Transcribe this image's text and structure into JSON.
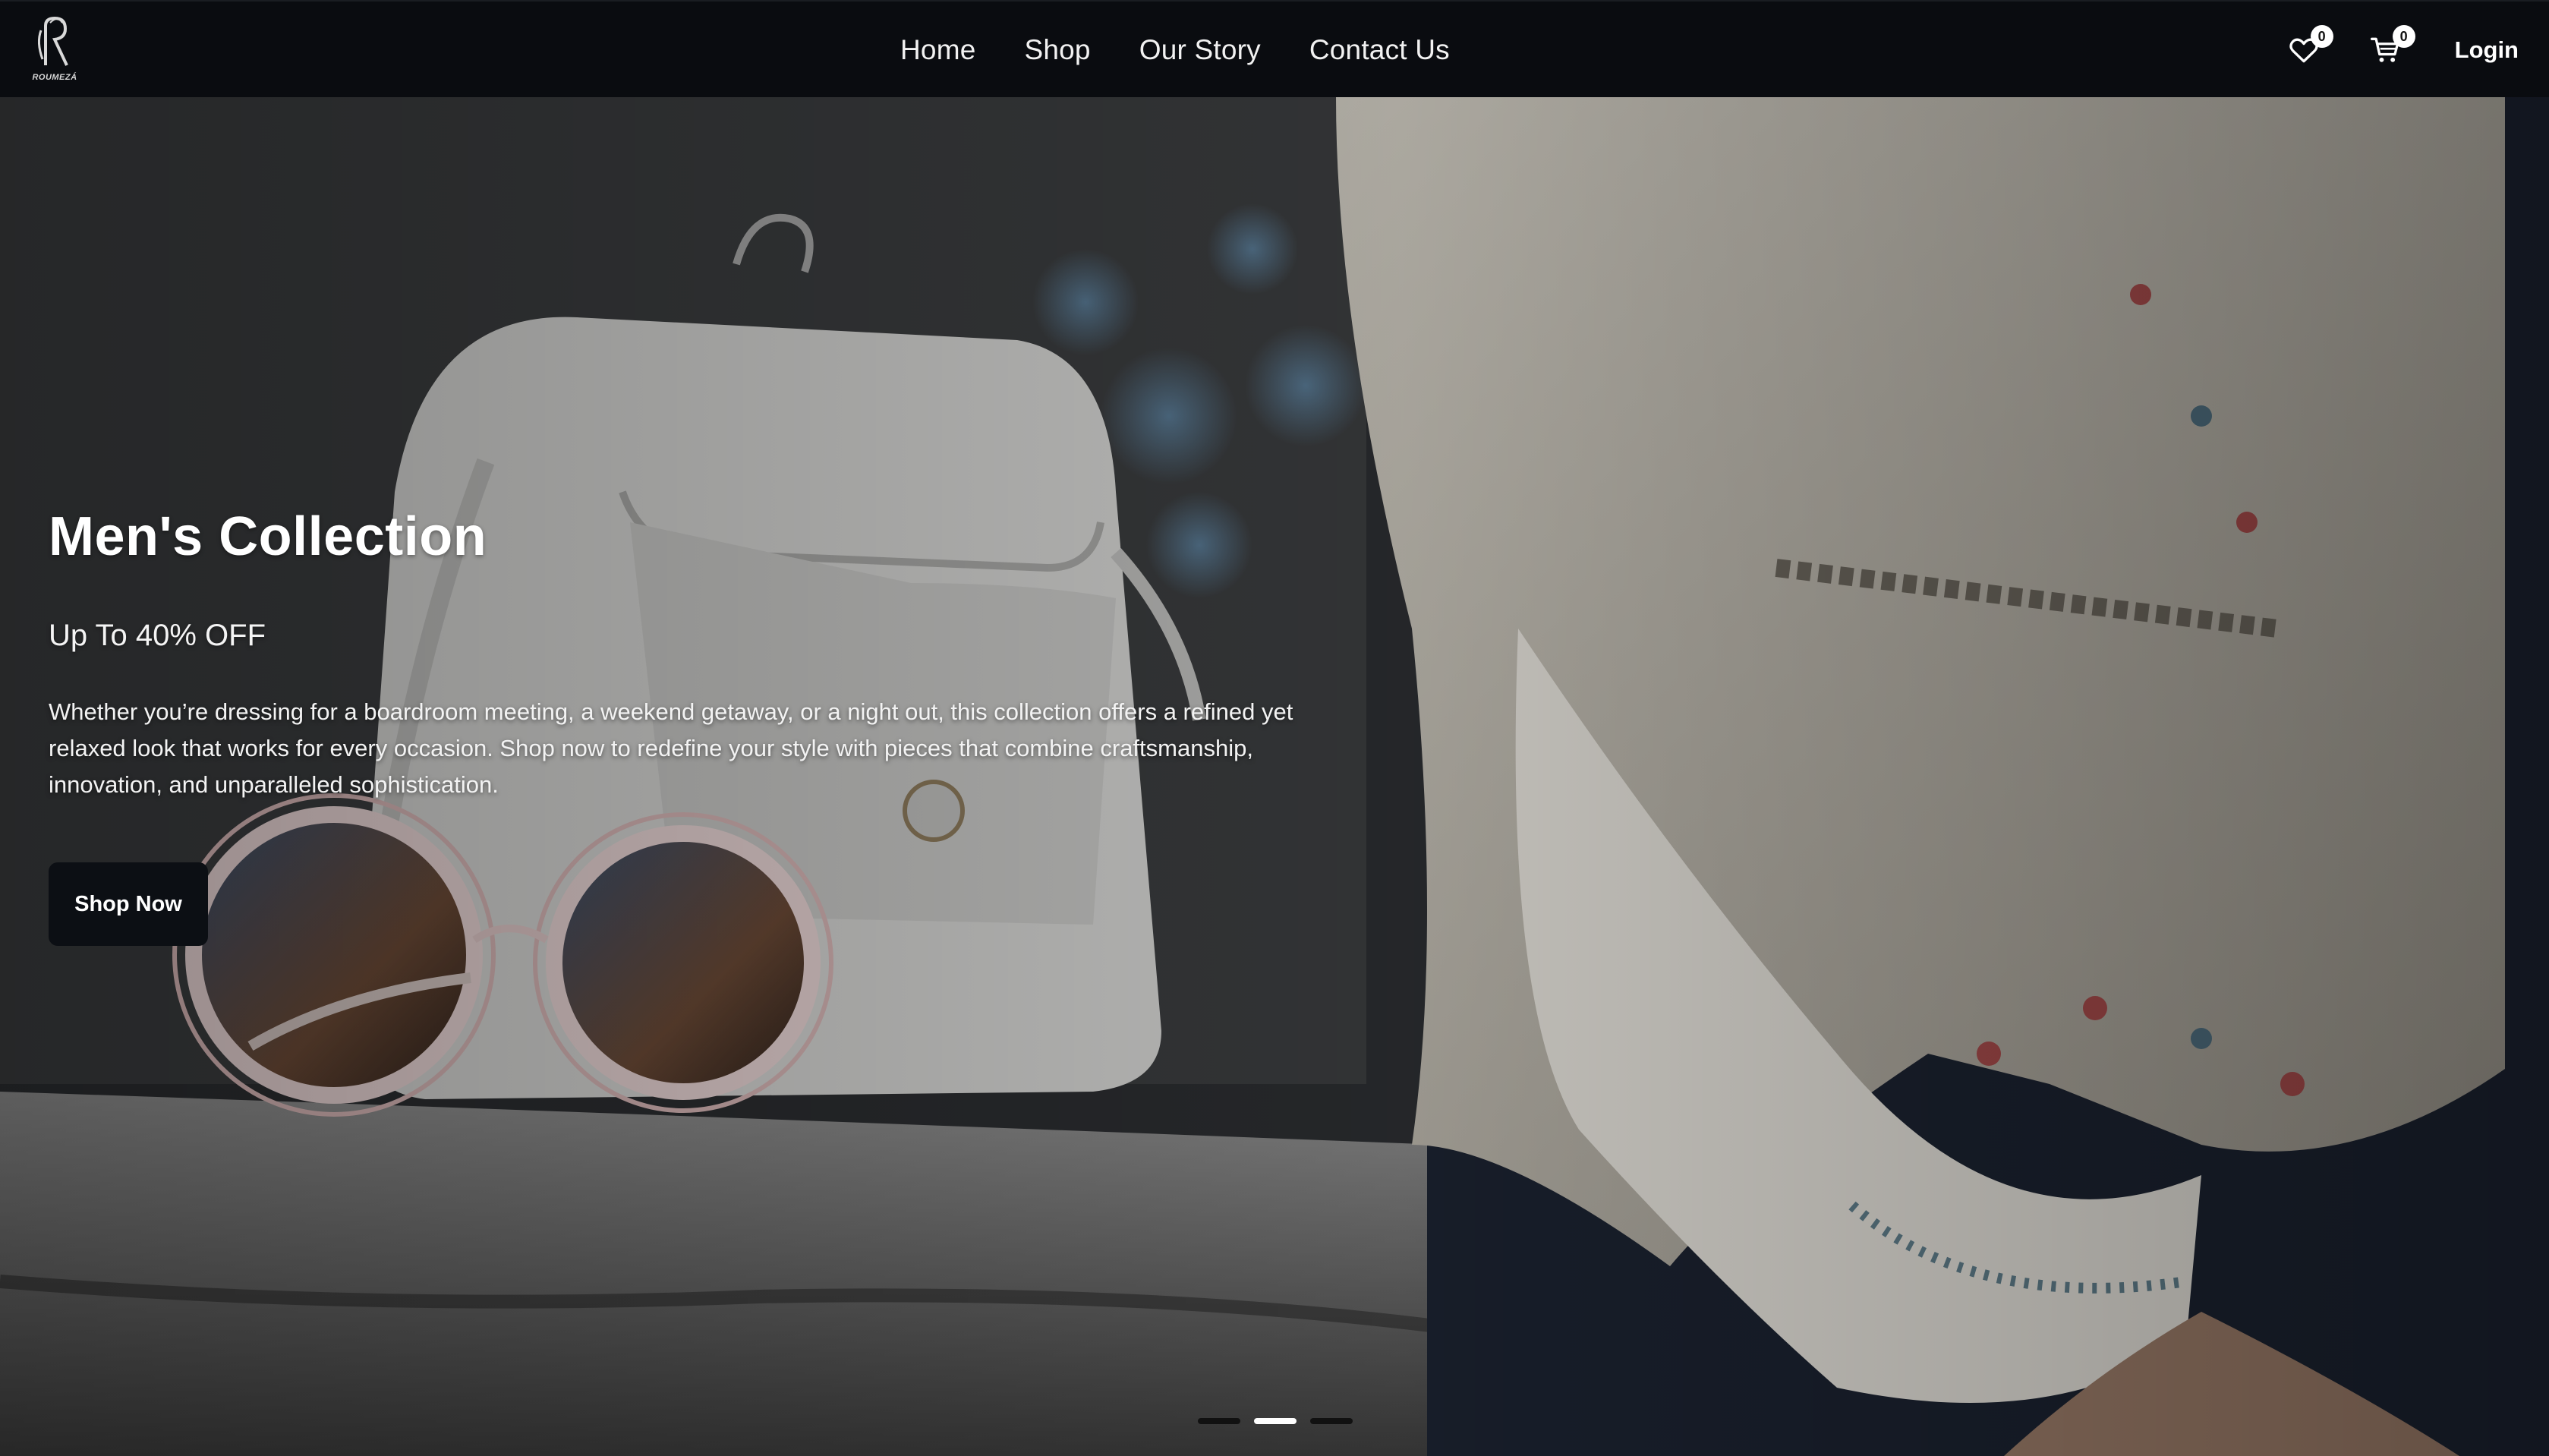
{
  "logo": {
    "icon": "monogram-r-icon",
    "text": "ROUMEZÁ"
  },
  "nav": {
    "links": [
      {
        "label": "Home"
      },
      {
        "label": "Shop"
      },
      {
        "label": "Our Story"
      },
      {
        "label": "Contact Us"
      }
    ],
    "wishlist": {
      "icon": "heart-icon",
      "count": "0"
    },
    "cart": {
      "icon": "cart-icon",
      "count": "0"
    },
    "login_label": "Login"
  },
  "hero": {
    "title": "Men's Collection",
    "subtitle": "Up To 40% OFF",
    "description": "Whether you’re dressing for a boardroom meeting, a weekend getaway, or a night out, this collection offers a refined yet relaxed look that works for every occasion. Shop now to redefine your style with pieces that combine craftsmanship, innovation, and unparalleled sophistication.",
    "cta_label": "Shop Now",
    "slides_total": 3,
    "active_slide": 2
  },
  "colors": {
    "navbar_bg": "#0a0c10",
    "button_bg": "#0c0f14",
    "text": "#ffffff"
  }
}
